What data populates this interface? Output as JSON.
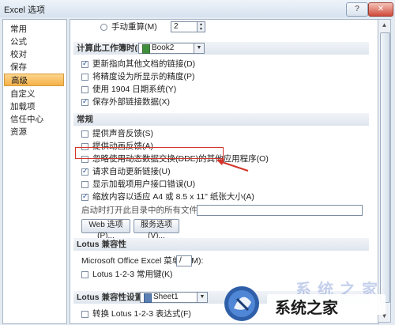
{
  "window": {
    "title": "Excel 选项",
    "help_glyph": "?",
    "close_glyph": "✕"
  },
  "sidebar": {
    "items": [
      {
        "label": "常用"
      },
      {
        "label": "公式"
      },
      {
        "label": "校对"
      },
      {
        "label": "保存"
      },
      {
        "label": "高级",
        "selected": true
      },
      {
        "label": "自定义"
      },
      {
        "label": "加载项"
      },
      {
        "label": "信任中心"
      },
      {
        "label": "资源"
      }
    ]
  },
  "calc": {
    "manual_recalc_label": "手动重算(M)",
    "manual_recalc_value": "2"
  },
  "workbook_calc": {
    "header": "计算此工作簿时(H):",
    "workbook_value": "Book2",
    "options": [
      {
        "label": "更新指向其他文档的链接(D)",
        "checked": true
      },
      {
        "label": "将精度设为所显示的精度(P)",
        "checked": false
      },
      {
        "label": "使用 1904 日期系统(Y)",
        "checked": false
      },
      {
        "label": "保存外部链接数据(X)",
        "checked": true
      }
    ]
  },
  "general": {
    "header": "常规",
    "options": [
      {
        "label": "提供声音反馈(S)",
        "checked": false
      },
      {
        "label": "提供动画反馈(A)",
        "checked": false
      },
      {
        "label": "忽略使用动态数据交换(DDE)的其他应用程序(O)",
        "checked": false
      },
      {
        "label": "请求自动更新链接(U)",
        "checked": true
      },
      {
        "label": "显示加载项用户接口错误(U)",
        "checked": false
      },
      {
        "label": "缩放内容以适应 A4 或 8.5 x 11\" 纸张大小(A)",
        "checked": true
      }
    ],
    "startup_label": "启动时打开此目录中的所有文件(L):",
    "web_options_button": "Web 选项(P)...",
    "service_options_button": "服务选项(V)..."
  },
  "lotus_compat": {
    "header": "Lotus 兼容性",
    "menu_key_label": "Microsoft Office Excel 菜单键(M):",
    "menu_key_value": "/",
    "nav_keys_label": "Lotus 1-2-3 常用键(K)",
    "nav_keys_checked": false
  },
  "lotus_settings": {
    "header": "Lotus 兼容性设置(L):",
    "sheet_value": "Sheet1",
    "transition_formula_label": "转换 Lotus 1-2-3 表达式(F)",
    "transition_formula_checked": false
  },
  "watermark": {
    "text": "系统之家",
    "faded_text": "系统之家"
  },
  "colors": {
    "accent": "#f6b048",
    "highlight": "#d4352b"
  }
}
